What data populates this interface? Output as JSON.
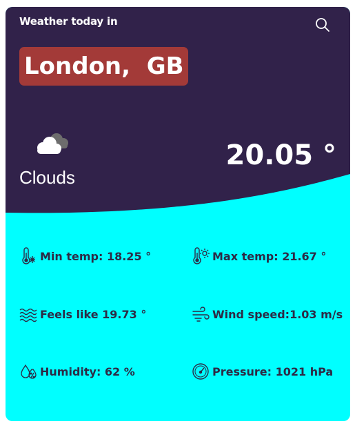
{
  "header": {
    "title": "Weather today in",
    "search_icon": "search-icon"
  },
  "location": {
    "city": "London,  GB",
    "badge_color": "#a33a38"
  },
  "current": {
    "condition": "Clouds",
    "condition_icon": "cloud-icon",
    "temperature": "20.05 °"
  },
  "stats": {
    "min_temp": "Min temp: 18.25 °",
    "max_temp": "Max temp: 21.67 °",
    "feels_like": "Feels like 19.73 °",
    "wind_speed": "Wind speed:1.03 m/s",
    "humidity": "Humidity: 62 %",
    "pressure": "Pressure: 1021 hPa"
  },
  "colors": {
    "header_bg": "#31224a",
    "body_bg": "#00ffff",
    "text_dark": "#2d2a45"
  }
}
